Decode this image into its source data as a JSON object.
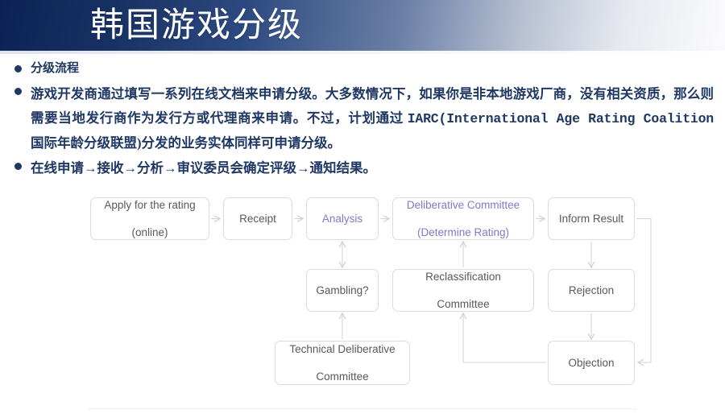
{
  "slide": {
    "title": "韩国游戏分级",
    "bullets": [
      {
        "text": "分级流程"
      },
      {
        "text_parts": [
          {
            "type": "cjk",
            "text": "游戏开发商通过填写一系列在线文档来申请分级。大多数情况下，如果你是非本地游戏厂商，没有相关资质，那么则需要当地发行商作为发行方或代理商来申请。不过，计划通过 "
          },
          {
            "type": "mono",
            "text": "IARC(International Age Rating Coalition "
          },
          {
            "type": "cjk",
            "text": "国际年龄分级联盟)"
          },
          {
            "type": "cjk",
            "text": "分发的业务实体同样可申请分级。"
          }
        ]
      },
      {
        "text": "在线申请→接收→分析→审议委员会确定评级→通知结果。"
      }
    ],
    "colors": {
      "header_dark": "#0c2256",
      "header_light": "#fbfbfd",
      "bullet_text": "#1f3864",
      "node_text": "#595959",
      "node_accent": "#8379c4",
      "node_border": "#dcdcdc",
      "connector": "#d0d0d0"
    }
  },
  "flowchart": {
    "nodes": [
      {
        "id": "apply",
        "label_line1": "Apply for the rating",
        "label_line2": "(online)",
        "accent": false
      },
      {
        "id": "receipt",
        "label_line1": "Receipt",
        "label_line2": "",
        "accent": false
      },
      {
        "id": "analysis",
        "label_line1": "Analysis",
        "label_line2": "",
        "accent": true
      },
      {
        "id": "delib",
        "label_line1": "Deliberative Committee",
        "label_line2": "(Determine Rating)",
        "accent": true
      },
      {
        "id": "inform",
        "label_line1": "Inform Result",
        "label_line2": "",
        "accent": false
      },
      {
        "id": "gambling",
        "label_line1": "Gambling?",
        "label_line2": "",
        "accent": false
      },
      {
        "id": "reclass",
        "label_line1": "Reclassification",
        "label_line2": "Committee",
        "accent": false
      },
      {
        "id": "rejection",
        "label_line1": "Rejection",
        "label_line2": "",
        "accent": false
      },
      {
        "id": "technical",
        "label_line1": "Technical Deliberative",
        "label_line2": "Committee",
        "accent": false
      },
      {
        "id": "objection",
        "label_line1": "Objection",
        "label_line2": "",
        "accent": false
      }
    ],
    "edges": [
      {
        "from": "apply",
        "to": "receipt",
        "style": "arrow-right"
      },
      {
        "from": "receipt",
        "to": "analysis",
        "style": "arrow-right"
      },
      {
        "from": "analysis",
        "to": "delib",
        "style": "arrow-right"
      },
      {
        "from": "delib",
        "to": "inform",
        "style": "arrow-right"
      },
      {
        "from": "gambling",
        "to": "analysis",
        "style": "arrow-double-vertical"
      },
      {
        "from": "reclass",
        "to": "delib",
        "style": "arrow-up"
      },
      {
        "from": "inform",
        "to": "rejection",
        "style": "arrow-down"
      },
      {
        "from": "rejection",
        "to": "objection",
        "style": "arrow-down"
      },
      {
        "from": "technical",
        "to": "gambling",
        "style": "arrow-up"
      },
      {
        "from": "objection",
        "to": "reclass",
        "style": "elbow-left-up"
      },
      {
        "from": "inform",
        "to": "objection",
        "style": "elbow-right-down"
      }
    ]
  }
}
